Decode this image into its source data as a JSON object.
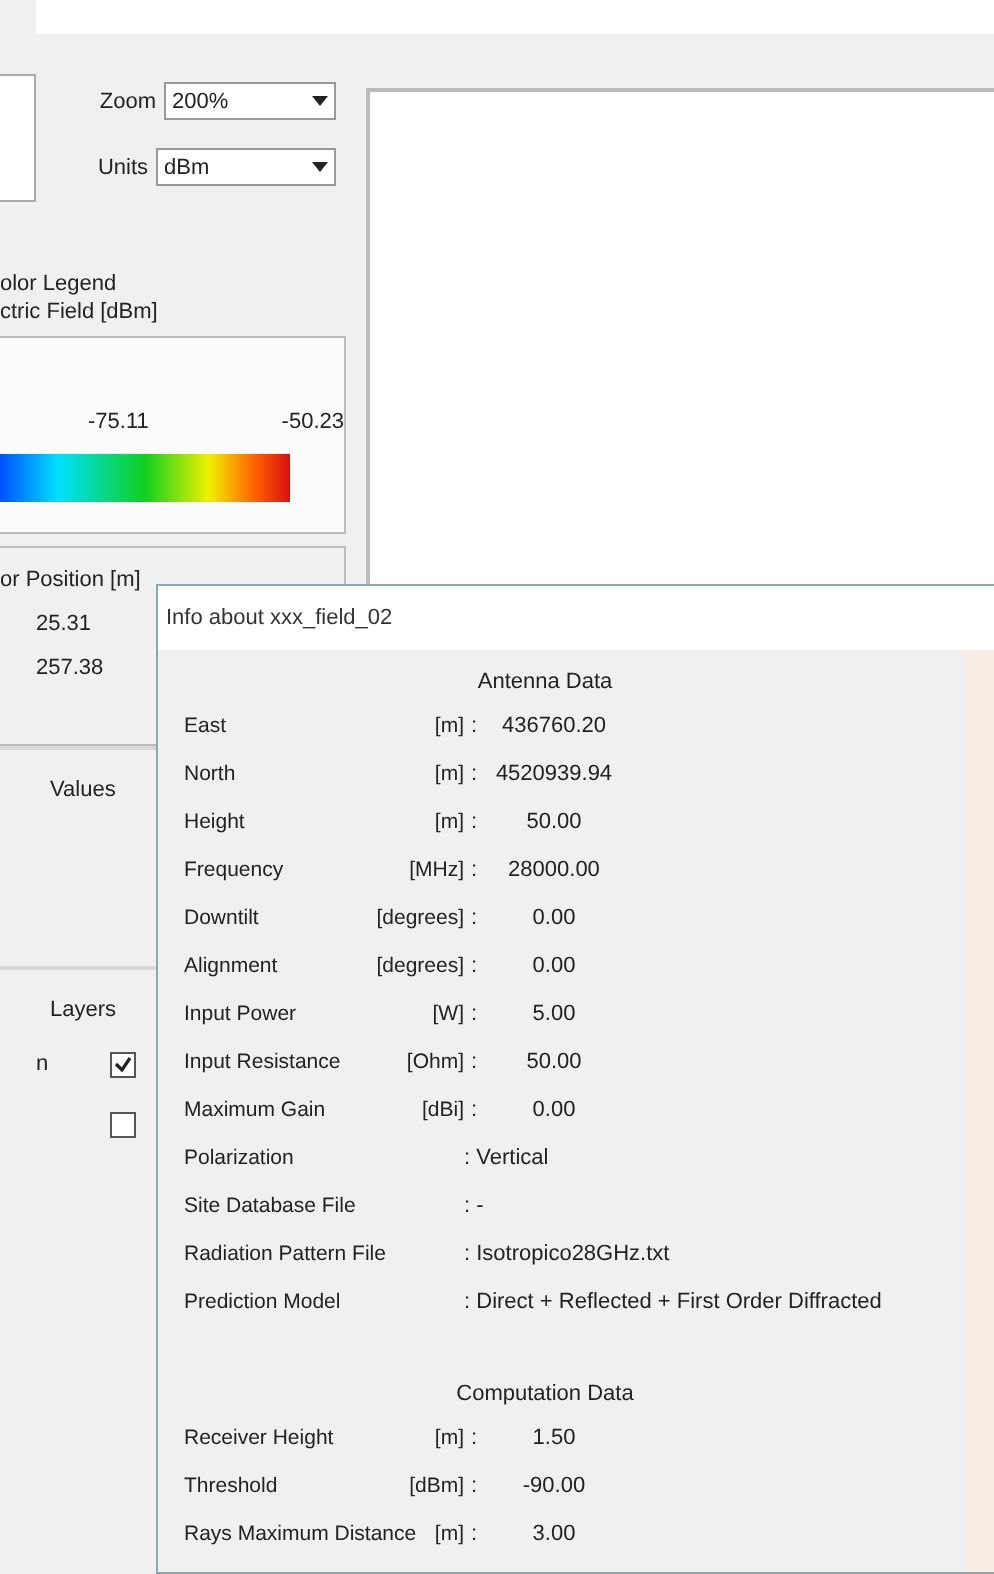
{
  "toolbar": {
    "zoom": {
      "label": "Zoom",
      "value": "200%"
    },
    "units": {
      "label": "Units",
      "value": "dBm"
    }
  },
  "legend": {
    "title_lines": [
      "olor Legend",
      "ctric Field [dBm]"
    ],
    "tick_labels": [
      "-75.11",
      "-50.23"
    ]
  },
  "receiver_position": {
    "title": "or Position  [m]",
    "values": [
      "25.31",
      "257.38"
    ]
  },
  "sections": [
    {
      "title": "Values"
    },
    {
      "title": "Layers"
    }
  ],
  "layers": [
    {
      "label": "n",
      "checked": true
    },
    {
      "checked": false
    }
  ],
  "info_dialog": {
    "title": "Info about  xxx_field_02",
    "groups": [
      {
        "heading": "Antenna Data",
        "rows": [
          {
            "kind": "number",
            "label": "East",
            "unit": "[m]",
            "separator": ":",
            "value": "436760.20"
          },
          {
            "kind": "number",
            "label": "North",
            "unit": "[m]",
            "separator": ":",
            "value": "4520939.94"
          },
          {
            "kind": "number",
            "label": "Height",
            "unit": "[m]",
            "separator": ":",
            "value": "50.00"
          },
          {
            "kind": "number",
            "label": "Frequency",
            "unit": "[MHz]",
            "separator": ":",
            "value": "28000.00"
          },
          {
            "kind": "number",
            "label": "Downtilt",
            "unit": "[degrees]",
            "separator": ":",
            "value": "0.00"
          },
          {
            "kind": "number",
            "label": "Alignment",
            "unit": "[degrees]",
            "separator": ":",
            "value": "0.00"
          },
          {
            "kind": "number",
            "label": "Input Power",
            "unit": "[W]",
            "separator": ":",
            "value": "5.00"
          },
          {
            "kind": "number",
            "label": "Input Resistance",
            "unit": "[Ohm]",
            "separator": ":",
            "value": "50.00"
          },
          {
            "kind": "number",
            "label": "Maximum Gain",
            "unit": "[dBi]",
            "separator": ":",
            "value": "0.00"
          },
          {
            "kind": "text",
            "label": "Polarization",
            "separator": ":",
            "value": "Vertical"
          },
          {
            "kind": "text",
            "label": "Site Database File",
            "separator": ":",
            "value": "-"
          },
          {
            "kind": "text",
            "label": "Radiation Pattern File",
            "separator": ":",
            "value": "Isotropico28GHz.txt"
          },
          {
            "kind": "text",
            "label": "Prediction Model",
            "separator": ":",
            "value": "Direct + Reflected + First Order Diffracted"
          }
        ]
      },
      {
        "heading": "Computation Data",
        "rows": [
          {
            "kind": "number",
            "label": "Receiver Height",
            "unit": "[m]",
            "separator": ":",
            "value": "1.50"
          },
          {
            "kind": "number",
            "label": "Threshold",
            "unit": "[dBm]",
            "separator": ":",
            "value": "-90.00"
          },
          {
            "kind": "number",
            "label": "Rays Maximum Distance",
            "unit": "[m]",
            "separator": ":",
            "value": "3.00"
          }
        ]
      }
    ]
  }
}
